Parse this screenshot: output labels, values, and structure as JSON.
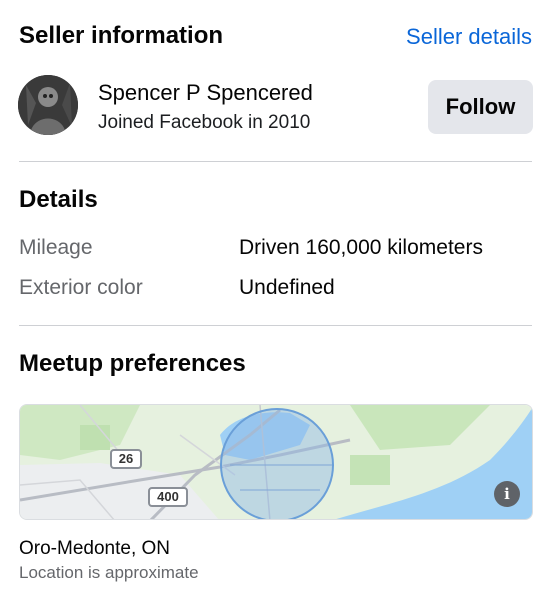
{
  "seller_section": {
    "title": "Seller information",
    "details_link": "Seller details",
    "name": "Spencer P Spencered",
    "joined": "Joined Facebook in 2010",
    "follow_label": "Follow"
  },
  "details_section": {
    "title": "Details",
    "rows": [
      {
        "label": "Mileage",
        "value": "Driven 160,000 kilometers"
      },
      {
        "label": "Exterior color",
        "value": "Undefined"
      }
    ]
  },
  "meetup_section": {
    "title": "Meetup preferences",
    "map": {
      "road_labels": [
        "26",
        "400"
      ],
      "info_icon": "i"
    },
    "location": "Oro-Medonte, ON",
    "location_note": "Location is approximate"
  },
  "colors": {
    "link": "#0a66d8",
    "water": "#9fd0f5",
    "land": "#e4f0dc",
    "radius_circle": "#6a9fd8"
  }
}
